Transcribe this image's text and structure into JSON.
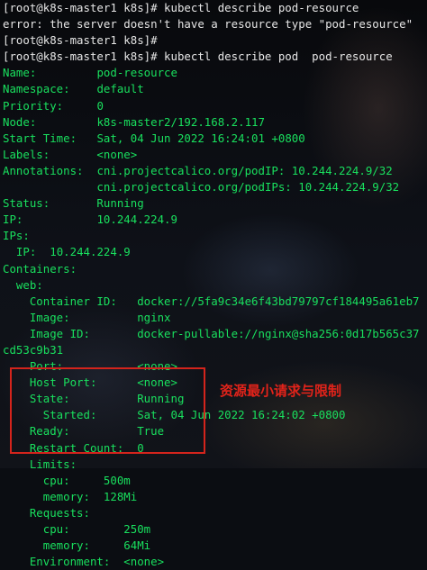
{
  "terminal": {
    "lines": [
      {
        "a": "[root@k8s-master1 k8s]# kubectl describe pod-resource",
        "b": ""
      },
      {
        "a": "error: the server doesn't have a resource type \"pod-resource\"",
        "b": ""
      },
      {
        "a": "[root@k8s-master1 k8s]#",
        "b": ""
      },
      {
        "a": "[root@k8s-master1 k8s]# kubectl describe pod  pod-resource",
        "b": ""
      },
      {
        "a": "Name:",
        "b": "         pod-resource"
      },
      {
        "a": "Namespace:",
        "b": "    default"
      },
      {
        "a": "Priority:",
        "b": "     0"
      },
      {
        "a": "Node:",
        "b": "         k8s-master2/192.168.2.117"
      },
      {
        "a": "Start Time:",
        "b": "   Sat, 04 Jun 2022 16:24:01 +0800"
      },
      {
        "a": "Labels:",
        "b": "       <none>"
      },
      {
        "a": "Annotations:",
        "b": "  cni.projectcalico.org/podIP: 10.244.224.9/32"
      },
      {
        "a": "",
        "b": "              cni.projectcalico.org/podIPs: 10.244.224.9/32"
      },
      {
        "a": "Status:",
        "b": "       Running"
      },
      {
        "a": "IP:",
        "b": "           10.244.224.9"
      },
      {
        "a": "IPs:",
        "b": ""
      },
      {
        "a": "  IP:",
        "b": "  10.244.224.9"
      },
      {
        "a": "Containers:",
        "b": ""
      },
      {
        "a": "  web:",
        "b": ""
      },
      {
        "a": "    Container ID:",
        "b": "   docker://5fa9c34e6f43bd79797cf184495a61eb7"
      },
      {
        "a": "    Image:",
        "b": "          nginx"
      },
      {
        "a": "    Image ID:",
        "b": "       docker-pullable://nginx@sha256:0d17b565c37"
      },
      {
        "a": "cd53c9b31",
        "b": ""
      },
      {
        "a": "    Port:",
        "b": "           <none>"
      },
      {
        "a": "    Host Port:",
        "b": "      <none>"
      },
      {
        "a": "    State:",
        "b": "          Running"
      },
      {
        "a": "      Started:",
        "b": "      Sat, 04 Jun 2022 16:24:02 +0800"
      },
      {
        "a": "    Ready:",
        "b": "          True"
      },
      {
        "a": "    Restart Count:",
        "b": "  0"
      },
      {
        "a": "    Limits:",
        "b": ""
      },
      {
        "a": "      cpu:",
        "b": "     500m"
      },
      {
        "a": "      memory:",
        "b": "  128Mi"
      },
      {
        "a": "    Requests:",
        "b": ""
      },
      {
        "a": "      cpu:",
        "b": "        250m"
      },
      {
        "a": "      memory:",
        "b": "     64Mi"
      },
      {
        "a": "    Environment:",
        "b": "  <none>"
      }
    ]
  },
  "annotation": {
    "note": "资源最小请求与限制",
    "box_color": "#d4241c"
  }
}
